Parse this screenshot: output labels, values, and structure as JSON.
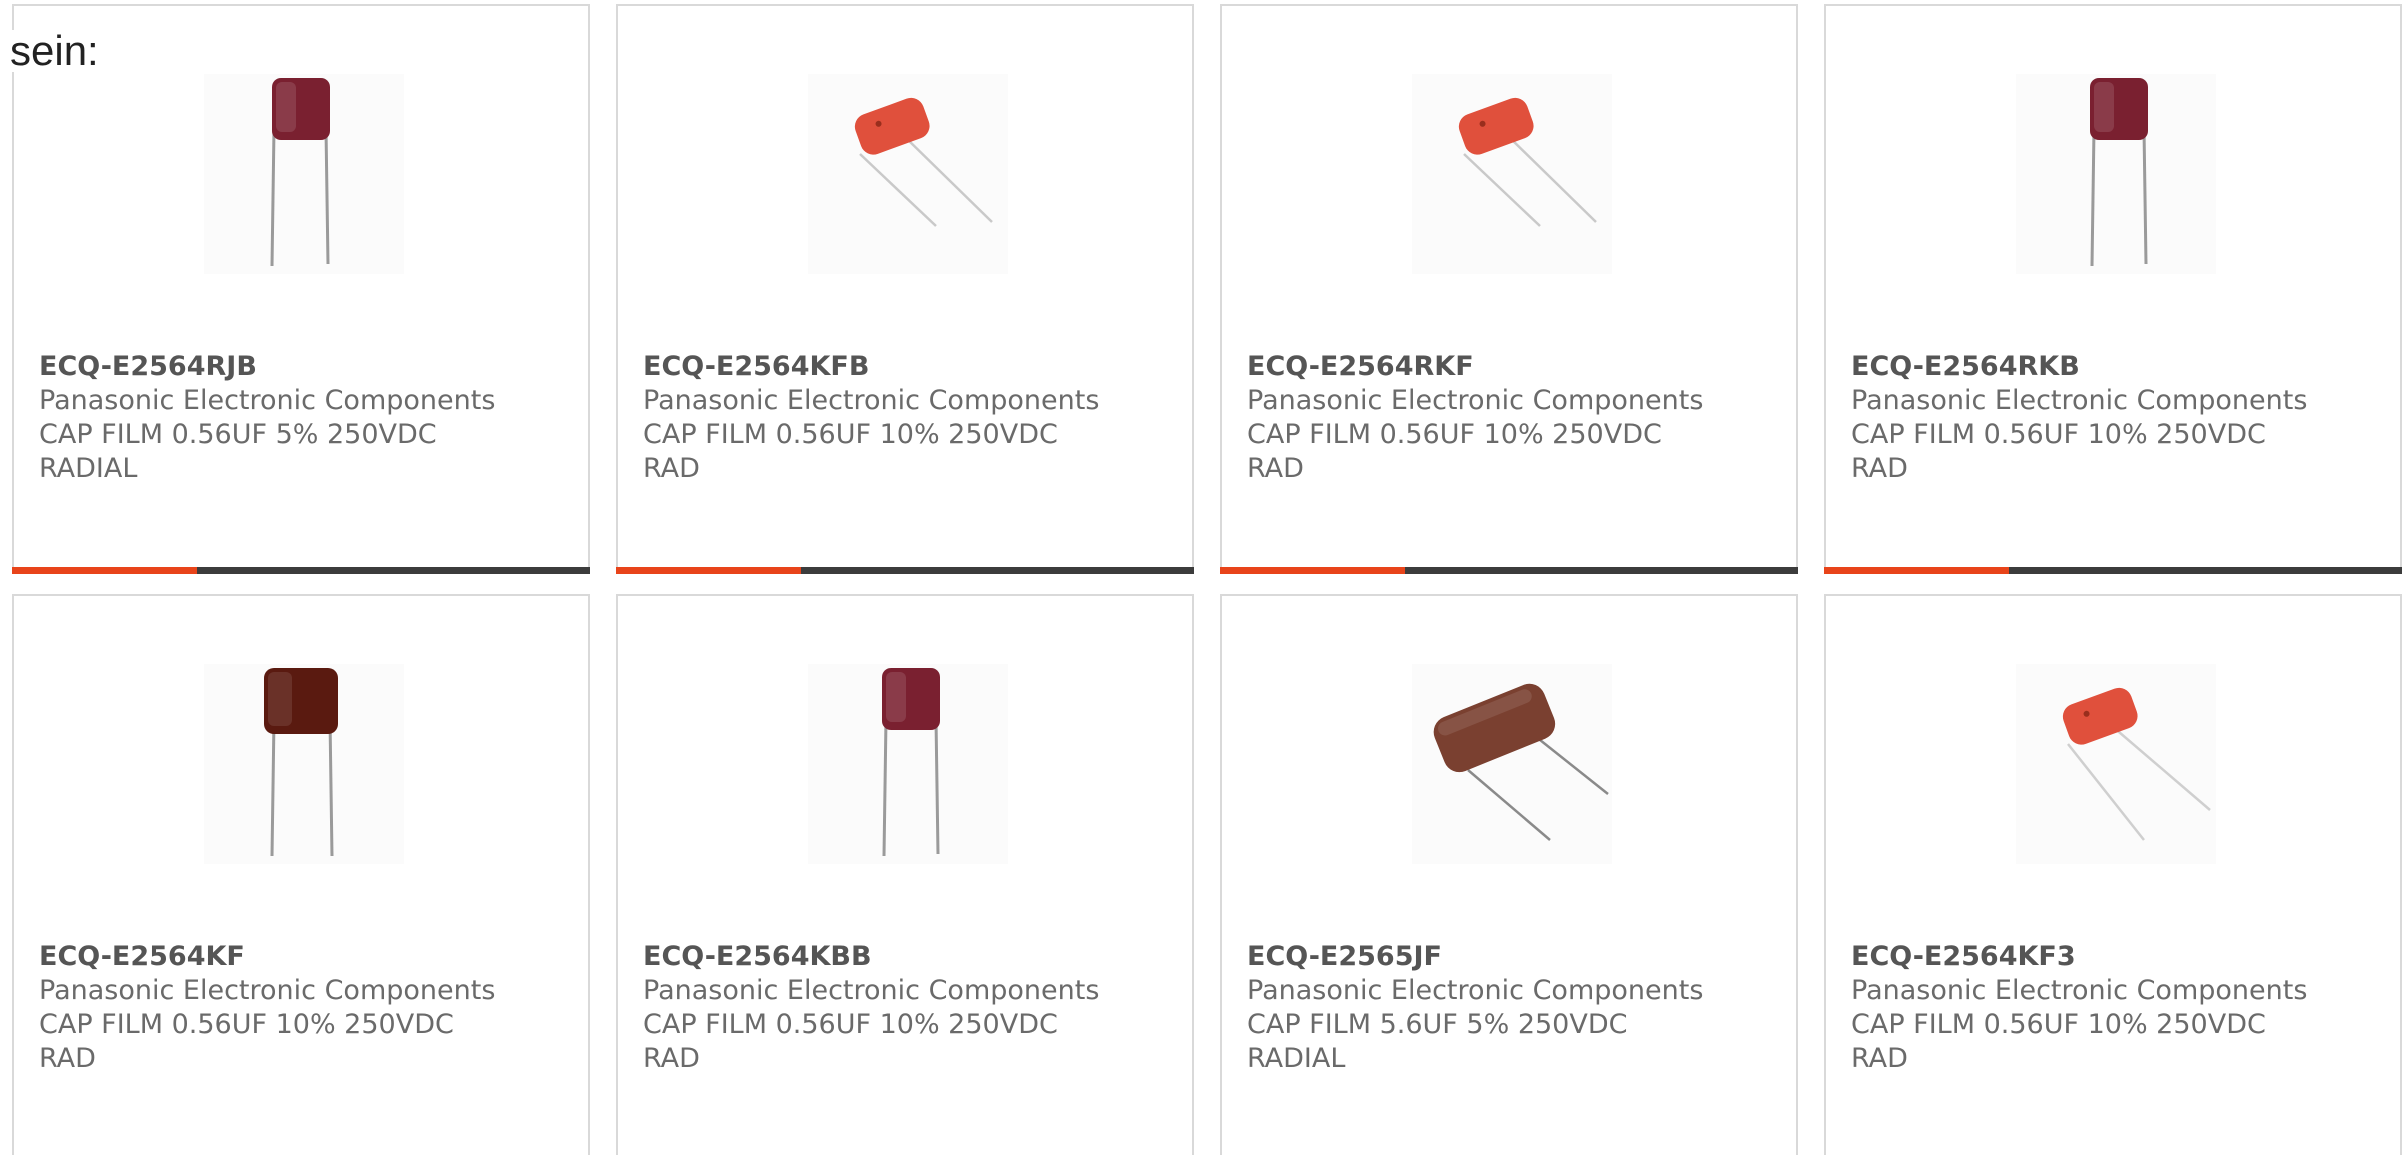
{
  "page": {
    "lead_text": "sein:"
  },
  "colors": {
    "progress_accent": "#e8441a",
    "progress_track": "#3c3c3c",
    "card_border": "#d9d9d9"
  },
  "products": [
    {
      "part_number": "ECQ-E2564RJB",
      "manufacturer": "Panasonic Electronic Components",
      "description": "CAP FILM 0.56UF 5% 250VDC RADIAL",
      "image": "upright-maroon-film-capacitor",
      "body_color": "#7a2030",
      "progress_fraction": 0.32
    },
    {
      "part_number": "ECQ-E2564KFB",
      "manufacturer": "Panasonic Electronic Components",
      "description": "CAP FILM 0.56UF 10% 250VDC RAD",
      "image": "tilted-orange-film-capacitor",
      "body_color": "#e0503c",
      "progress_fraction": 0.32
    },
    {
      "part_number": "ECQ-E2564RKF",
      "manufacturer": "Panasonic Electronic Components",
      "description": "CAP FILM 0.56UF 10% 250VDC RAD",
      "image": "tilted-orange-film-capacitor",
      "body_color": "#e0503c",
      "progress_fraction": 0.32
    },
    {
      "part_number": "ECQ-E2564RKB",
      "manufacturer": "Panasonic Electronic Components",
      "description": "CAP FILM 0.56UF 10% 250VDC RAD",
      "image": "upright-maroon-film-capacitor",
      "body_color": "#7a2030",
      "progress_fraction": 0.32
    },
    {
      "part_number": "ECQ-E2564KF",
      "manufacturer": "Panasonic Electronic Components",
      "description": "CAP FILM 0.56UF 10% 250VDC RAD",
      "image": "upright-brown-film-capacitor",
      "body_color": "#5a1a10",
      "progress_fraction": null
    },
    {
      "part_number": "ECQ-E2564KBB",
      "manufacturer": "Panasonic Electronic Components",
      "description": "CAP FILM 0.56UF 10% 250VDC RAD",
      "image": "upright-maroon-film-capacitor",
      "body_color": "#7a2030",
      "progress_fraction": null
    },
    {
      "part_number": "ECQ-E2565JF",
      "manufacturer": "Panasonic Electronic Components",
      "description": "CAP FILM 5.6UF 5% 250VDC RADIAL",
      "image": "tilted-brown-film-capacitor",
      "body_color": "#7a4030",
      "progress_fraction": null
    },
    {
      "part_number": "ECQ-E2564KF3",
      "manufacturer": "Panasonic Electronic Components",
      "description": "CAP FILM 0.56UF 10% 250VDC RAD",
      "image": "tilted-orange-film-capacitor",
      "body_color": "#e0503c",
      "progress_fraction": null
    }
  ]
}
